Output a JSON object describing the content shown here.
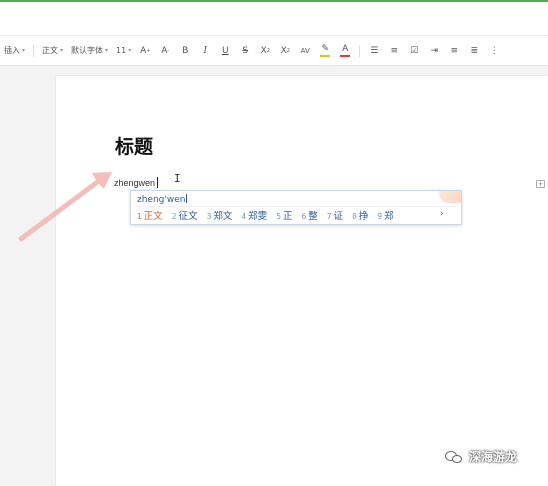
{
  "toolbar": {
    "insert": "插入",
    "style": "正文",
    "font": "默认字体",
    "font_size": "11"
  },
  "document": {
    "title": "标题",
    "typed_text": "zhengwen"
  },
  "ime": {
    "composition": "zheng'wen",
    "candidates": [
      {
        "num": "1",
        "word": "正文"
      },
      {
        "num": "2",
        "word": "征文"
      },
      {
        "num": "3",
        "word": "郑文"
      },
      {
        "num": "4",
        "word": "郑雯"
      },
      {
        "num": "5",
        "word": "正"
      },
      {
        "num": "6",
        "word": "整"
      },
      {
        "num": "7",
        "word": "证"
      },
      {
        "num": "8",
        "word": "挣"
      },
      {
        "num": "9",
        "word": "郑"
      }
    ],
    "next": "›"
  },
  "watermark": {
    "text": "深海游龙"
  },
  "colors": {
    "accent_green": "#4caf50",
    "highlight_yellow": "#f2c200",
    "font_red": "#e53935",
    "ime_blue": "#2c5aa0",
    "ime_selected": "#d9642e",
    "arrow": "#f2b8b3"
  }
}
